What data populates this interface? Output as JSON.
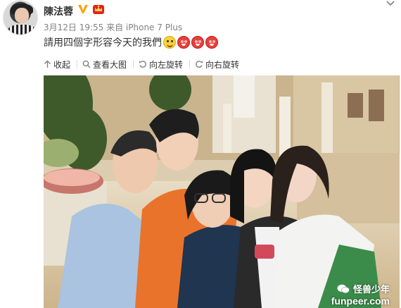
{
  "post": {
    "username": "陳法蓉",
    "meta_text": "3月12日 19:55 来自 iPhone 7 Plus",
    "text": "請用四個字形容今天的我們"
  },
  "toolbar": {
    "collapse_label": "收起",
    "view_large_label": "查看大图",
    "rotate_left_label": "向左旋转",
    "rotate_right_label": "向右旋转"
  },
  "icons": {
    "collapse": "arrow-up-icon",
    "view_large": "search-icon",
    "rotate_left": "rotate-left-icon",
    "rotate_right": "rotate-right-icon",
    "menu": "chevron-down-icon"
  },
  "watermark": {
    "brand": "怪兽少年",
    "site": "funpeer.com"
  },
  "colors": {
    "text": "#333333",
    "meta": "#808080",
    "vip": "#f7a400",
    "member": "#e2231a"
  }
}
